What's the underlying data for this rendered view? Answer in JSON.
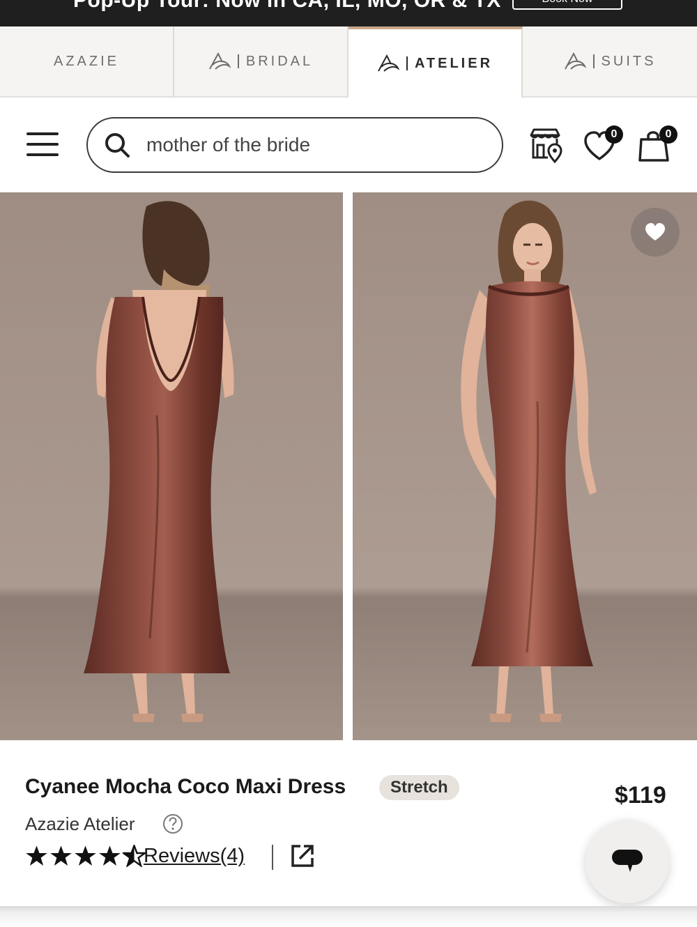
{
  "promo": {
    "text": "Pop-Up Tour: Now in CA, IL, MO, OR & TX",
    "button_label": "Book Now"
  },
  "tabs": [
    {
      "label": "AZAZIE",
      "active": false
    },
    {
      "label": "BRIDAL",
      "active": false
    },
    {
      "label": "ATELIER",
      "active": true
    },
    {
      "label": "SUITS",
      "active": false
    }
  ],
  "header": {
    "search_value": "mother of the bride",
    "wishlist_count": "0",
    "cart_count": "0"
  },
  "product": {
    "title": "Cyanee Mocha Coco Maxi Dress",
    "tag": "Stretch",
    "price": "$119",
    "brand": "Azazie Atelier",
    "rating": 4.5,
    "reviews_label": "Reviews(4)"
  },
  "colors": {
    "dress": "#7a3e33",
    "background": "#a39288",
    "accent_tab": "#c9a98a"
  }
}
